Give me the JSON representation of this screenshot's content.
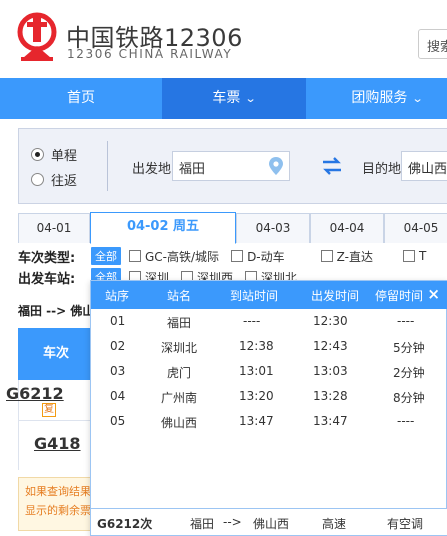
{
  "header": {
    "brand_cn": "中国铁路12306",
    "brand_en": "12306 CHINA RAILWAY",
    "search_text": "搜索",
    "brand_color": "#e6262d"
  },
  "nav": {
    "items": [
      {
        "label": "首页",
        "has_chevron": false
      },
      {
        "label": "车票",
        "has_chevron": true
      },
      {
        "label": "团购服务",
        "has_chevron": true
      }
    ],
    "chevron": "⌄"
  },
  "query": {
    "trip_one_way": "单程",
    "trip_round": "往返",
    "from_label": "出发地",
    "from_value": "福田",
    "to_label": "目的地",
    "to_value": "佛山西"
  },
  "date_tabs": [
    "04-01",
    "04-02 周五",
    "04-03",
    "04-04",
    "04-05"
  ],
  "filters": {
    "type_label": "车次类型:",
    "station_label": "出发车站:",
    "all_label": "全部",
    "types": [
      "GC-高铁/城际",
      "D-动车",
      "Z-直达",
      "T"
    ],
    "stations": [
      "深圳",
      "深圳西",
      "深圳北"
    ]
  },
  "route_summary": "福田 --> 佛山",
  "results": {
    "col_train": "车次",
    "trains": [
      "G6212",
      "G418"
    ],
    "fu_badge": "复",
    "notice_line1": "如果查询结果",
    "notice_line2": "显示的剩余票"
  },
  "stop_popup": {
    "headers": [
      "站序",
      "站名",
      "到站时间",
      "出发时间",
      "停留时间"
    ],
    "close": "×",
    "stops": [
      {
        "seq": "01",
        "name": "福田",
        "arrive": "----",
        "depart": "12:30",
        "stay": "----"
      },
      {
        "seq": "02",
        "name": "深圳北",
        "arrive": "12:38",
        "depart": "12:43",
        "stay": "5分钟"
      },
      {
        "seq": "03",
        "name": "虎门",
        "arrive": "13:01",
        "depart": "13:03",
        "stay": "2分钟"
      },
      {
        "seq": "04",
        "name": "广州南",
        "arrive": "13:20",
        "depart": "13:28",
        "stay": "8分钟"
      },
      {
        "seq": "05",
        "name": "佛山西",
        "arrive": "13:47",
        "depart": "13:47",
        "stay": "----"
      }
    ],
    "footer": {
      "train": "G6212次",
      "from": "福田",
      "arrow": "-->",
      "to": "佛山西",
      "class": "高速",
      "aircon": "有空调"
    }
  }
}
